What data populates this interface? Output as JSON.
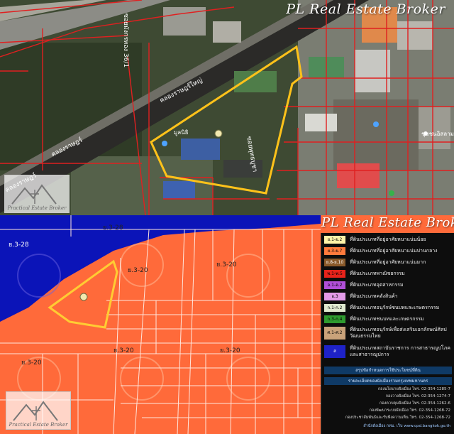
{
  "watermark": "PL Real Estate Broker",
  "logo_caption": "Practical Estate Broker",
  "satellite": {
    "road_labels": [
      "คลองราษฎร์",
      "คลองราษฎร์",
      "คลองราษฎร์ใหญ่",
      "ซอยพุทธบูชา",
      "ซอยมังกรทอง 36/1"
    ],
    "place_label": "มูลนิธิ",
    "right_label": "ชุมชนอิสลาม"
  },
  "zoning_labels": [
    "ย.3-28",
    "ย.3-28",
    "ย.3-20",
    "ย.3-20",
    "ย.3-20",
    "ย.3-20",
    "ย.3-20"
  ],
  "legend": {
    "items": [
      {
        "code": "ย.1-ย.2",
        "label": "ที่ดินประเภทที่อยู่อาศัยหนาแน่นน้อย",
        "color": "#fff3a8"
      },
      {
        "code": "ย.3-ย.7",
        "label": "ที่ดินประเภทที่อยู่อาศัยหนาแน่นปานกลาง",
        "color": "#ff7a3c"
      },
      {
        "code": "ย.8-ย.10",
        "label": "ที่ดินประเภทที่อยู่อาศัยหนาแน่นมาก",
        "color": "#8a5a2a"
      },
      {
        "code": "พ.1-พ.5",
        "label": "ที่ดินประเภทพาณิชยกรรม",
        "color": "#e8231b"
      },
      {
        "code": "อ.1-อ.2",
        "label": "ที่ดินประเภทอุตสาหกรรม",
        "color": "#b14fd8"
      },
      {
        "code": "อ.3",
        "label": "ที่ดินประเภทคลังสินค้า",
        "color": "#e39be8"
      },
      {
        "code": "ก.1-ก.2",
        "label": "ที่ดินประเภทอนุรักษ์ชนบทและเกษตรกรรม",
        "color": "#dfe9cf"
      },
      {
        "code": "ก.3-ก.4",
        "label": "ที่ดินประเภทชนบทและเกษตรกรรม",
        "color": "#2f9b2f"
      },
      {
        "code": "ศ.1-ศ.2",
        "label": "ที่ดินประเภทอนุรักษ์เพื่อส่งเสริมเอกลักษณ์ศิลปวัฒนธรรมไทย",
        "color": "#c9a27a"
      },
      {
        "code": "ส",
        "label": "ที่ดินประเภทสถาบันราชการ การสาธารณูปโภคและสาธารณูปการ",
        "color": "#1e22c8"
      }
    ],
    "buttons": [
      "สรุปข้อกำหนดการใช้ประโยชน์ที่ดิน",
      "รายละเอียดของผังเมืองรวมกรุงเทพมหานคร"
    ],
    "contacts": [
      "กองนโยบายผังเมือง โทร. 02-354-1285-7",
      "กองวางผังเมือง โทร. 02-354-1274-7",
      "กองควบคุมผังเมือง โทร. 02-354-1262-6",
      "กองพัฒนาระบบผังเมือง โทร. 02-354-1268-72",
      "กองประชาสัมพันธ์และรับฟังความเห็น โทร. 02-354-1268-72",
      "สำนักผังเมือง กทม. เว็บ www.cpd.bangkok.go.th"
    ]
  },
  "colors": {
    "residential_medium": "#ff6a3a",
    "water": "#0b14b8",
    "site_outline": "#ffcc33"
  }
}
